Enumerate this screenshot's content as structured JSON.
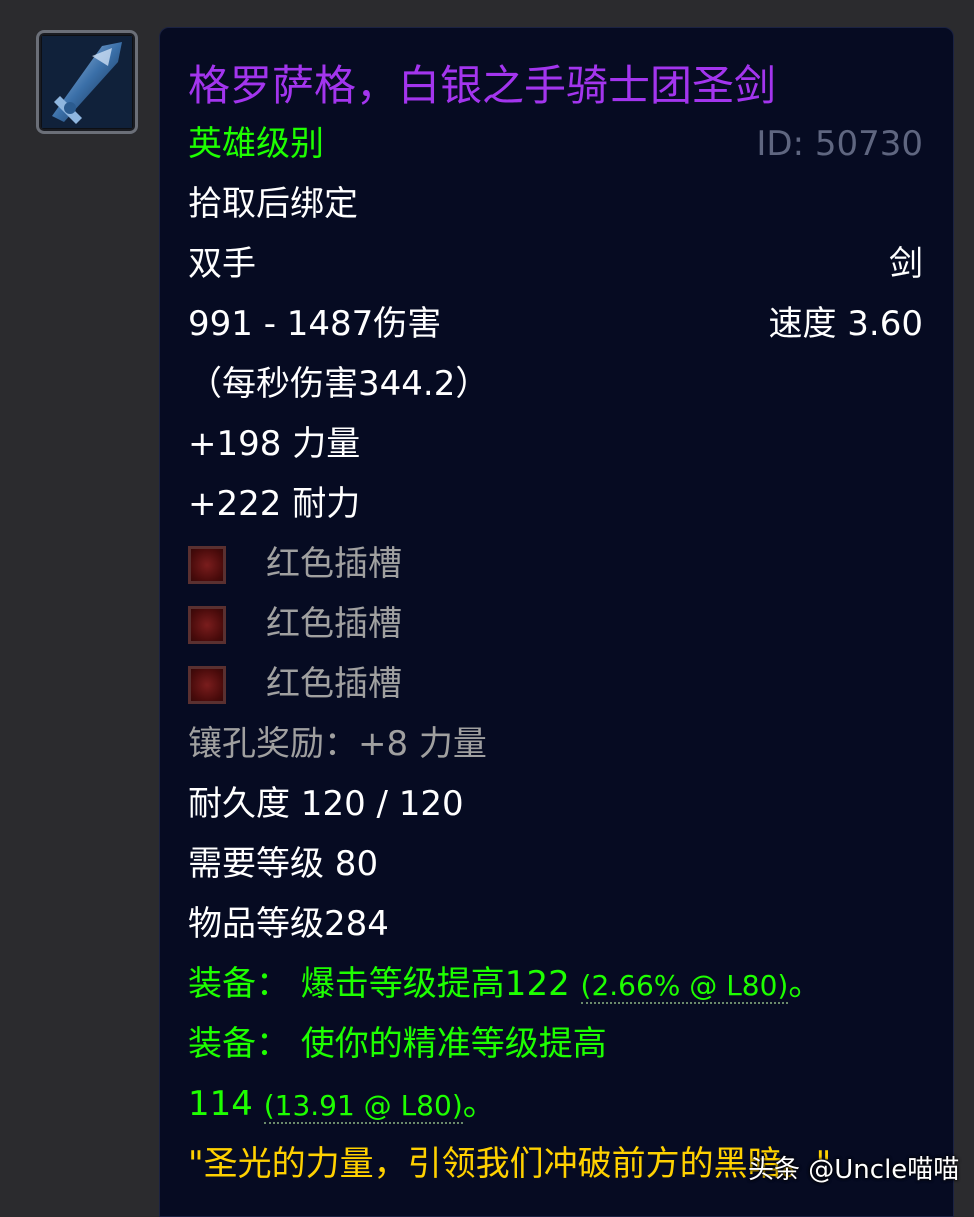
{
  "item": {
    "name": "格罗萨格，白银之手骑士团圣剑",
    "quality": "英雄级别",
    "id_label": "ID: 50730",
    "bind": "拾取后绑定",
    "slot": "双手",
    "type": "剑",
    "damage": "991 - 1487伤害",
    "speed": "速度 3.60",
    "dps": "（每秒伤害344.2）",
    "stats": [
      "+198 力量",
      "+222 耐力"
    ],
    "sockets": [
      "红色插槽",
      "红色插槽",
      "红色插槽"
    ],
    "socket_bonus": "镶孔奖励：+8 力量",
    "durability": "耐久度 120 / 120",
    "required_level": "需要等级 80",
    "item_level": "物品等级284",
    "equip1": {
      "prefix": "装备：  爆击等级提高122 ",
      "detail": "(2.66% @ L80)",
      "suffix": "。"
    },
    "equip2": {
      "line1": "装备：  使你的精准等级提高",
      "value": "114 ",
      "detail": "(13.91 @ L80)",
      "suffix": "。"
    },
    "flavor": "\"圣光的力量，引领我们冲破前方的黑暗。\""
  },
  "colors": {
    "epic": "#a335ee",
    "uncommon": "#1eff00",
    "flavor": "#ffd100",
    "gray": "#a0a0a0",
    "tooltip_bg": "#060b22"
  },
  "icon": "sword-item-icon",
  "socket_icon": "red-socket-icon",
  "watermark": "头条 @Uncle喵喵"
}
